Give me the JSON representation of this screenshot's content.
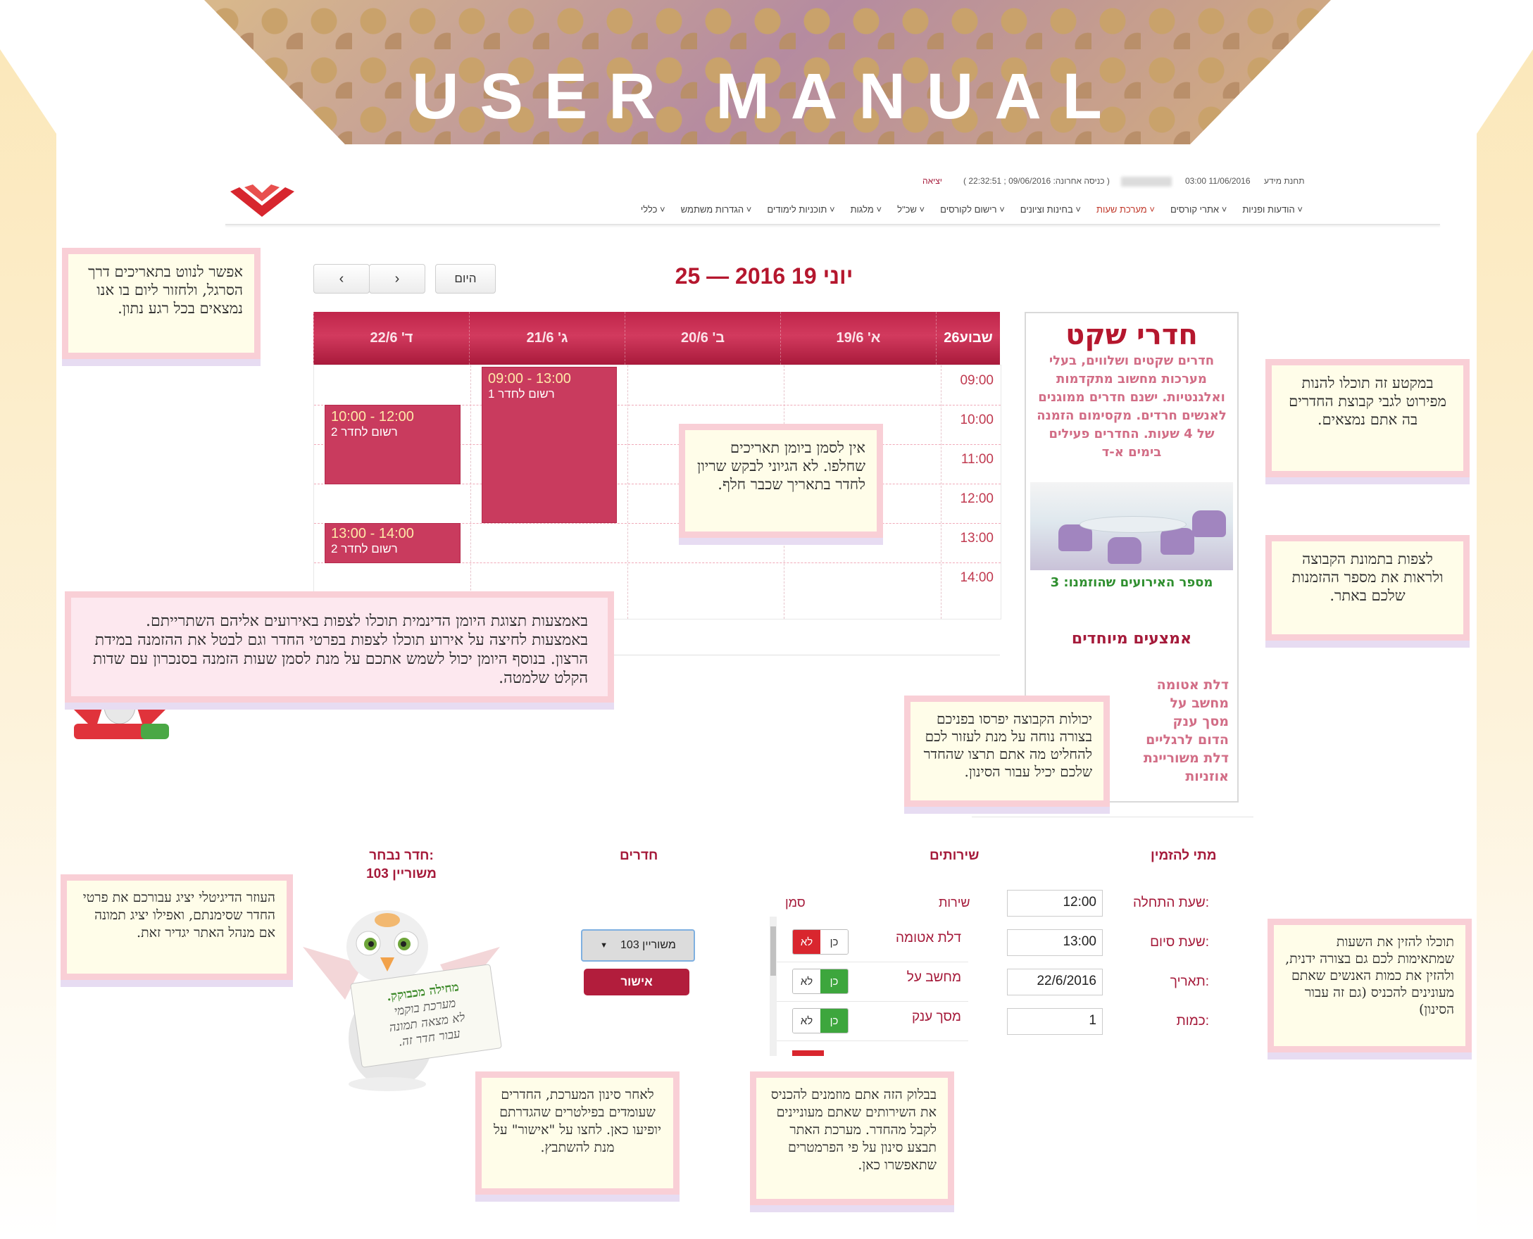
{
  "banner": {
    "title": "USER MANUAL"
  },
  "site": {
    "info_center": "תחנת מידע",
    "datetime": "03:00 11/06/2016",
    "last_login": "( כניסה אחרונה: 09/06/2016 ; 22:32:51 )",
    "logout": "יציאה",
    "menu": [
      "הודעות ופניות",
      "אתרי קורסים",
      "מערכת שעות",
      "בחינות וציונים",
      "רישום לקורסים",
      "שכ\"ל",
      "מלגות",
      "תוכניות לימודים",
      "הגדרות משתמש",
      "כללי"
    ],
    "active_menu_index": 2,
    "accent": "#b5172e"
  },
  "calendar": {
    "title": "יוני 19 2016 — 25",
    "today_button": "היום",
    "prev_icon": "chevron-left-icon",
    "next_icon": "chevron-right-icon",
    "week_label": "שבוע26",
    "days": [
      "א' 19/6",
      "ב' 20/6",
      "ג' 21/6",
      "ד' 22/6"
    ],
    "times": [
      "09:00",
      "10:00",
      "11:00",
      "12:00",
      "13:00",
      "14:00"
    ],
    "events": [
      {
        "time": "09:00 - 13:00",
        "room": "רשום לחדר 1"
      },
      {
        "time": "10:00 - 12:00",
        "room": "רשום לחדר 2"
      },
      {
        "time": "13:00 - 14:00",
        "room": "רשום לחדר 2"
      }
    ]
  },
  "panel": {
    "title": "חדרי שקט",
    "description": "חדרים שקטים ושלווים, בעלי מערכות מחשוב מתקדמות ואלגנטיות. ישנם חדרים ממוגנים לאנשים חרדים. מקסימום הזמנה של 4 שעות. החדרים פעילים בימים א-ד",
    "events_count": "מספר האירועים שהוזמנו: 3",
    "special_heading": "אמצעים מיוחדים",
    "special_items": [
      "דלת אטומה",
      "מחשב על",
      "מסך ענק",
      "הדום לרגליים",
      "דלת משוריינת",
      "אוזניות"
    ]
  },
  "form": {
    "when_heading": "מתי להזמין",
    "services_heading": "שירותים",
    "rooms_heading": "חדרים",
    "chosen_heading": "חדר נבחר:",
    "chosen_value": "משוריין 103",
    "start_label": "שעת התחלה:",
    "start_value": "12:00",
    "end_label": "שעת סיום:",
    "end_value": "13:00",
    "date_label": "תאריך:",
    "date_value": "22/6/2016",
    "qty_label": "כמות:",
    "qty_value": "1",
    "services_col_service": "שירות",
    "services_col_mark": "סמן",
    "services": [
      {
        "name": "דלת אטומה",
        "yes": "כן",
        "no": "לא",
        "selected": "no"
      },
      {
        "name": "מחשב על",
        "yes": "כן",
        "no": "לא",
        "selected": "yes"
      },
      {
        "name": "מסך ענק",
        "yes": "כן",
        "no": "לא",
        "selected": "yes"
      }
    ],
    "room_select": "משוריין 103",
    "confirm": "אישור"
  },
  "mascot": {
    "sign_line1": "מחילה מכבוקק.",
    "sign_line2": "מערכת בוקמי",
    "sign_line3": "לא מצאה תמונה",
    "sign_line4": "עבור חדר זה."
  },
  "notes": {
    "nav": "אפשר לנווט בתאריכים דרך הסרגל, ולחזור ליום בו אנו נמצאים בכל רגע נתון.",
    "overlap": "אין לסמן ביומן תאריכים שחלפו. לא הגיוני לבקש שריון לחדר בתאריך שכבר חלף.",
    "dynamic": "באמצעות תצוגת היומן הדינמית תוכלו לצפות באירועים אליהם השתרייתם. באמצעות לחיצה על אירוע תוכלו לצפות בפרטי החדר וגם לבטל את ההזמנה במידת הרצון. בנוסף היומן יכול לשמש אתכם על מנת לסמן שעות הזמנה בסנכרון עם שדות הקלט שלמטה.",
    "section": "במקטע זה תוכלו להנות מפירוט לגבי קבוצת החדרים בה אתם נמצאים.",
    "image": "לצפות בתמונת הקבוצה ולראות את מספר ההזמנות שלכם באתר.",
    "abilities": "יכולות הקבוצה יפרסו בפניכם בצורה נוחה על מנת לעזור לכם להחליט מה אתם תרצו שהחדר שלכם יכיל עבור הסינון.",
    "helper": "העוזר הדיגיטלי יציג עבורכם את פרטי החדר שסימנתם, ואפילו יציג תמונה אם מנהל האתר יגדיר זאת.",
    "hours": "תוכלו להזין את השעות שמתאימות לכם גם בצורה ידנית, ולהזין את כמות האנשים שאתם מעונינים להכניס (גם זה עבור הסינון)",
    "filter": "לאחר סינון המערכת, החדרים שעומדים בפילטרים שהגדרתם יופיעו כאן. לחצו על \"אישור\" על מנת להשתבץ.",
    "services": "בבלוק הזה אתם מוזמנים להכניס את השירותים שאתם מעוניינים לקבל מהחדר. מערכת האתר תבצע סינון על פי הפרמטרים שתאפשרו כאן."
  }
}
